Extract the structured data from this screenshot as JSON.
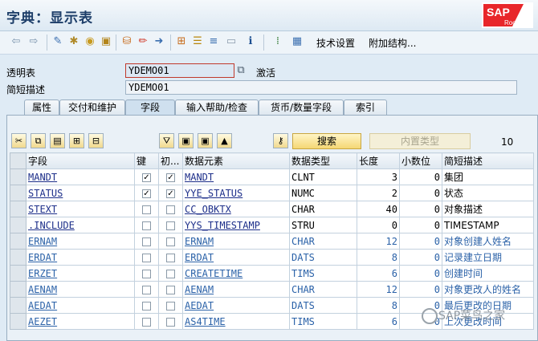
{
  "window": {
    "title": "字典：显示表"
  },
  "logo": {
    "brand": "SAP",
    "sub": "Rookie"
  },
  "toolbar": {
    "tech_settings": "技术设置",
    "append_struct": "附加结构..."
  },
  "header": {
    "table_label": "透明表",
    "table_value": "YDEMO01",
    "status": "激活",
    "desc_label": "简短描述",
    "desc_value": "YDEMO01"
  },
  "tabs": [
    "属性",
    "交付和维护",
    "字段",
    "输入帮助/检查",
    "货币/数量字段",
    "索引"
  ],
  "active_tab": "字段",
  "fields_toolbar": {
    "search_label": "搜索",
    "builtin_label": "内置类型",
    "count": "10"
  },
  "grid": {
    "headers": [
      "字段",
      "键",
      "初...",
      "数据元素",
      "数据类型",
      "长度",
      "小数位",
      "简短描述"
    ],
    "rows": [
      {
        "field": "MANDT",
        "key": true,
        "init": true,
        "elem": "MANDT",
        "type": "CLNT",
        "len": "3",
        "dec": "0",
        "desc": "集团",
        "blue": false
      },
      {
        "field": "STATUS",
        "key": true,
        "init": true,
        "elem": "YYE_STATUS",
        "type": "NUMC",
        "len": "2",
        "dec": "0",
        "desc": "状态",
        "blue": false
      },
      {
        "field": "STEXT",
        "key": false,
        "init": false,
        "elem": "CC_OBKTX",
        "type": "CHAR",
        "len": "40",
        "dec": "0",
        "desc": "对象描述",
        "blue": false
      },
      {
        "field": ".INCLUDE",
        "key": false,
        "init": false,
        "elem": "YYS_TIMESTAMP",
        "type": "STRU",
        "len": "0",
        "dec": "0",
        "desc": "TIMESTAMP",
        "blue": false
      },
      {
        "field": "ERNAM",
        "key": false,
        "init": false,
        "elem": "ERNAM",
        "type": "CHAR",
        "len": "12",
        "dec": "0",
        "desc": "对象创建人姓名",
        "blue": true
      },
      {
        "field": "ERDAT",
        "key": false,
        "init": false,
        "elem": "ERDAT",
        "type": "DATS",
        "len": "8",
        "dec": "0",
        "desc": "记录建立日期",
        "blue": true
      },
      {
        "field": "ERZET",
        "key": false,
        "init": false,
        "elem": "CREATETIME",
        "type": "TIMS",
        "len": "6",
        "dec": "0",
        "desc": "创建时间",
        "blue": true
      },
      {
        "field": "AENAM",
        "key": false,
        "init": false,
        "elem": "AENAM",
        "type": "CHAR",
        "len": "12",
        "dec": "0",
        "desc": "对象更改人的姓名",
        "blue": true
      },
      {
        "field": "AEDAT",
        "key": false,
        "init": false,
        "elem": "AEDAT",
        "type": "DATS",
        "len": "8",
        "dec": "0",
        "desc": "最后更改的日期",
        "blue": true
      },
      {
        "field": "AEZET",
        "key": false,
        "init": false,
        "elem": "AS4TIME",
        "type": "TIMS",
        "len": "6",
        "dec": "0",
        "desc": "上次更改时间",
        "blue": true
      }
    ]
  },
  "watermark": "SAP菜鸟之家"
}
